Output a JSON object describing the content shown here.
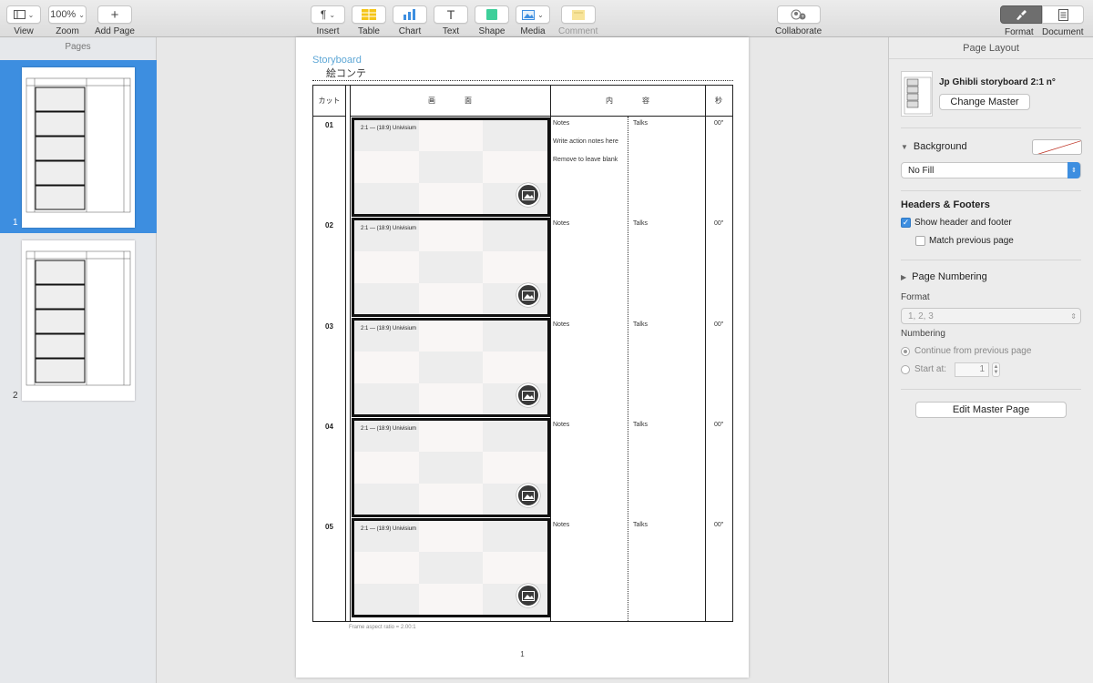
{
  "toolbar": {
    "view": "View",
    "zoom": "Zoom",
    "zoom_value": "100%",
    "add_page": "Add Page",
    "insert": "Insert",
    "table": "Table",
    "chart": "Chart",
    "text": "Text",
    "shape": "Shape",
    "media": "Media",
    "comment": "Comment",
    "collaborate": "Collaborate",
    "format": "Format",
    "document": "Document",
    "icons": [
      "view-icon",
      "plus-icon",
      "paragraph-icon",
      "table-icon",
      "chart-icon",
      "text-icon",
      "shape-icon",
      "media-icon",
      "comment-icon",
      "collaborate-icon",
      "format-brush-icon",
      "document-icon"
    ]
  },
  "sidebar": {
    "title": "Pages",
    "pages": [
      {
        "number": "1",
        "selected": true
      },
      {
        "number": "2",
        "selected": false
      }
    ]
  },
  "page": {
    "title": "Storyboard",
    "subtitle": "絵コンテ",
    "headers": {
      "cut": "カット",
      "screen": "画　　　　面",
      "content": "内　　　　容",
      "seconds": "秒"
    },
    "frame_label": "2:1 — (18:9) Univisium",
    "footnote": "Frame aspect ratio = 2.00:1",
    "page_number": "1",
    "cuts": [
      {
        "num": "01",
        "notes": "Notes",
        "note2": "Write action notes here",
        "note3": "Remove to leave blank",
        "talks": "Talks",
        "sec": "00″"
      },
      {
        "num": "02",
        "notes": "Notes",
        "talks": "Talks",
        "sec": "00″"
      },
      {
        "num": "03",
        "notes": "Notes",
        "talks": "Talks",
        "sec": "00″"
      },
      {
        "num": "04",
        "notes": "Notes",
        "talks": "Talks",
        "sec": "00″"
      },
      {
        "num": "05",
        "notes": "Notes",
        "talks": "Talks",
        "sec": "00″"
      }
    ]
  },
  "inspector": {
    "title": "Page Layout",
    "master_name": "Jp Ghibli storyboard 2:1 n°",
    "change_master": "Change Master",
    "background": {
      "label": "Background",
      "fill": "No Fill"
    },
    "headers_footers": {
      "label": "Headers & Footers",
      "show": "Show header and footer",
      "show_checked": true,
      "match": "Match previous page",
      "match_checked": false
    },
    "page_numbering": {
      "label": "Page Numbering",
      "format_label": "Format",
      "format_value": "1, 2, 3",
      "numbering_label": "Numbering",
      "continue": "Continue from previous page",
      "start_at": "Start at:",
      "start_value": "1"
    },
    "edit_master": "Edit Master Page"
  },
  "colors": {
    "accent": "#3d8ee0",
    "storyboard_title": "#5ea7d6"
  }
}
